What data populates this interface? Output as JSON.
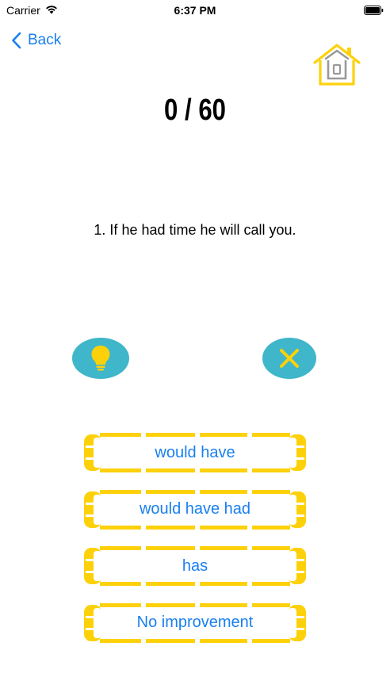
{
  "status_bar": {
    "carrier": "Carrier",
    "time": "6:37 PM"
  },
  "nav": {
    "back_label": "Back"
  },
  "quiz": {
    "score": "0 / 60",
    "question": "1. If he had time he will call you."
  },
  "answers": [
    {
      "label": "would have"
    },
    {
      "label": "would have had"
    },
    {
      "label": "has"
    },
    {
      "label": "No improvement"
    }
  ],
  "icons": {
    "back": "chevron-left-icon",
    "home": "home-icon",
    "hint": "lightbulb-icon",
    "close": "close-icon"
  },
  "colors": {
    "accent_blue": "#1a7ff0",
    "teal": "#3fb6c9",
    "yellow": "#fdd10a"
  }
}
